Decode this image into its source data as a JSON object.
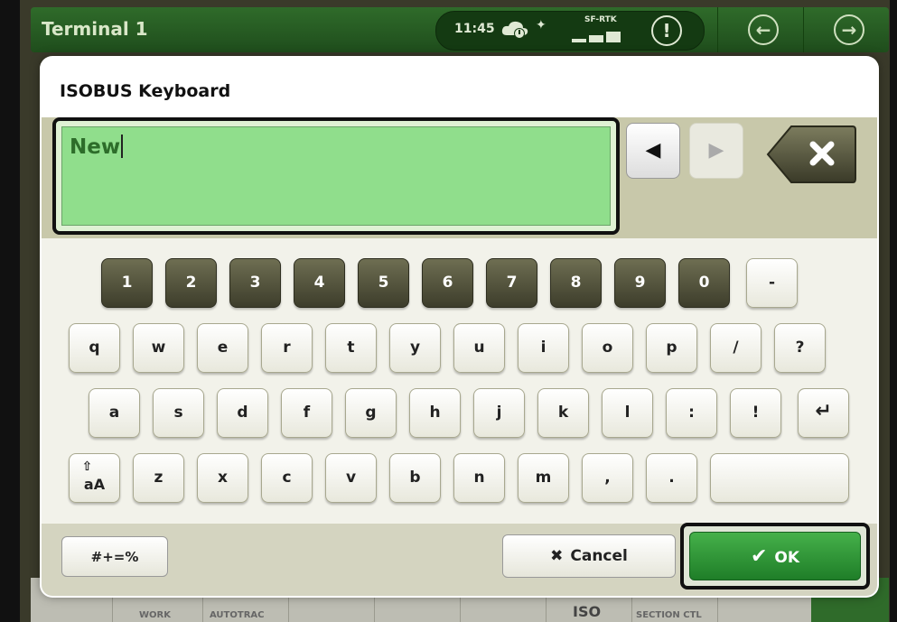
{
  "terminal": {
    "title": "Terminal 1"
  },
  "status": {
    "time": "11:45",
    "gps_label": "SF-RTK",
    "alert_glyph": "!"
  },
  "nav": {
    "back_glyph": "←",
    "forward_glyph": "→"
  },
  "bottom_strip": {
    "labels": [
      "WORK",
      "AUTOTRAC",
      "ISO",
      "SECTION CTL"
    ]
  },
  "dialog": {
    "title": "ISOBUS Keyboard",
    "input_value": "New",
    "cursor_left_glyph": "◀",
    "cursor_right_glyph": "▶"
  },
  "keys": {
    "row1": [
      "1",
      "2",
      "3",
      "4",
      "5",
      "6",
      "7",
      "8",
      "9",
      "0",
      "-"
    ],
    "row2": [
      "q",
      "w",
      "e",
      "r",
      "t",
      "y",
      "u",
      "i",
      "o",
      "p",
      "/",
      "?"
    ],
    "row3": [
      "a",
      "s",
      "d",
      "f",
      "g",
      "h",
      "j",
      "k",
      "l",
      ":",
      "!",
      "↵"
    ],
    "row4": [
      "z",
      "x",
      "c",
      "v",
      "b",
      "n",
      "m",
      ",",
      "."
    ],
    "shift_label": "aA",
    "space_label": ""
  },
  "footer": {
    "symbols_label": "#+=%",
    "cancel_label": "Cancel",
    "cancel_glyph": "✖",
    "ok_label": "OK",
    "ok_glyph": "✔"
  },
  "colors": {
    "brand_green": "#2f6b2a",
    "entry_green": "#90de8c",
    "number_key": "#4a4a35",
    "ok_green": "#2e9b36"
  }
}
